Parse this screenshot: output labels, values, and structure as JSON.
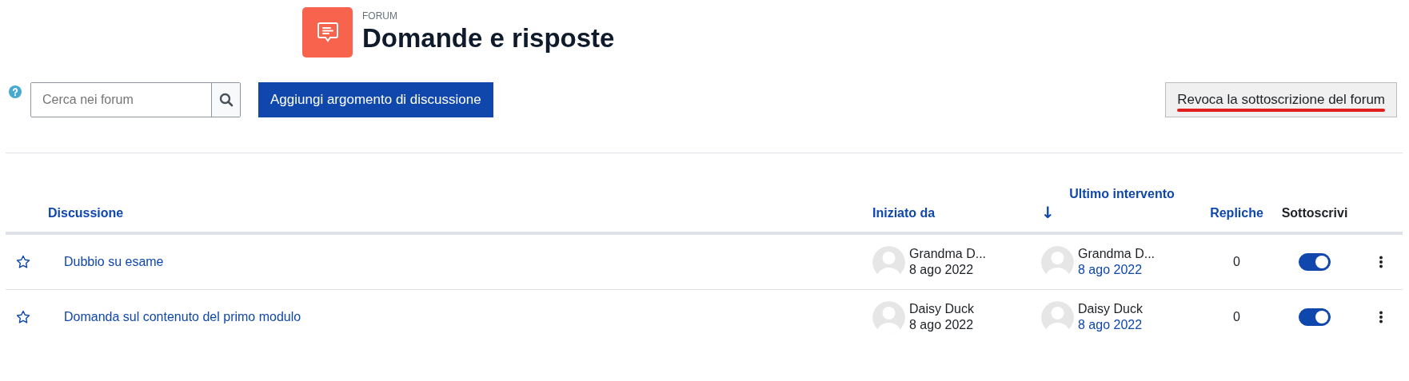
{
  "header": {
    "kind_label": "FORUM",
    "title": "Domande e risposte"
  },
  "search": {
    "placeholder": "Cerca nei forum"
  },
  "add_button": "Aggiungi argomento di discussione",
  "unsubscribe_button": {
    "label": "Revoca la sottoscrizione del forum",
    "underlined": true
  },
  "table": {
    "columns": [
      {
        "label": "Discussione",
        "kind": "link"
      },
      {
        "label": "Iniziato da",
        "kind": "link"
      },
      {
        "label": "Ultimo intervento",
        "kind": "link",
        "sort_arrow": "↓"
      },
      {
        "label": "Repliche",
        "kind": "link"
      },
      {
        "label": "Sottoscrivi",
        "kind": "plain"
      }
    ],
    "rows": [
      {
        "starred": false,
        "title": "Dubbio su esame",
        "started_by": "Grandma D...",
        "started_date": "8 ago 2022",
        "last_by": "Grandma D...",
        "last_date": "8 ago 2022",
        "replies": "0",
        "subscribed": true
      },
      {
        "starred": false,
        "title": "Domanda sul contenuto del primo modulo",
        "started_by": "Daisy Duck",
        "started_date": "8 ago 2022",
        "last_by": "Daisy Duck",
        "last_date": "8 ago 2022",
        "replies": "0",
        "subscribed": true
      }
    ]
  }
}
